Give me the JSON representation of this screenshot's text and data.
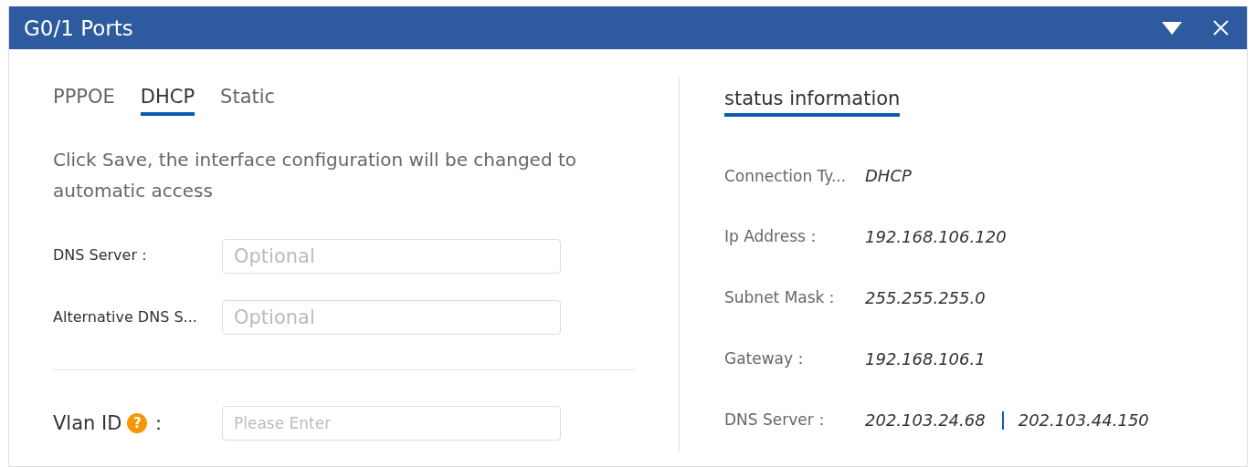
{
  "window": {
    "title": "G0/1 Ports"
  },
  "tabs": [
    {
      "label": "PPPOE",
      "selected": false
    },
    {
      "label": "DHCP",
      "selected": true
    },
    {
      "label": "Static",
      "selected": false
    }
  ],
  "description": "Click Save, the interface configuration will be changed to automatic access",
  "dns_fields": [
    {
      "label": "DNS Server：",
      "placeholder": "Optional"
    },
    {
      "label": "Alternative DNS S...",
      "placeholder": "Optional"
    }
  ],
  "vlan_field": {
    "label": "Vlan ID",
    "help": "?",
    "label_suffix": "：",
    "placeholder": "Please Enter"
  },
  "status": {
    "title": "status information",
    "selected": true,
    "rows": [
      {
        "label": "Connection Ty...",
        "values": [
          "DHCP"
        ]
      },
      {
        "label": "Ip Address：",
        "values": [
          "192.168.106.120"
        ]
      },
      {
        "label": "Subnet Mask：",
        "values": [
          "255.255.255.0"
        ]
      },
      {
        "label": "Gateway：",
        "values": [
          "192.168.106.1"
        ]
      },
      {
        "label": "DNS Server：",
        "values": [
          "202.103.24.68",
          "202.103.44.150"
        ]
      }
    ]
  }
}
